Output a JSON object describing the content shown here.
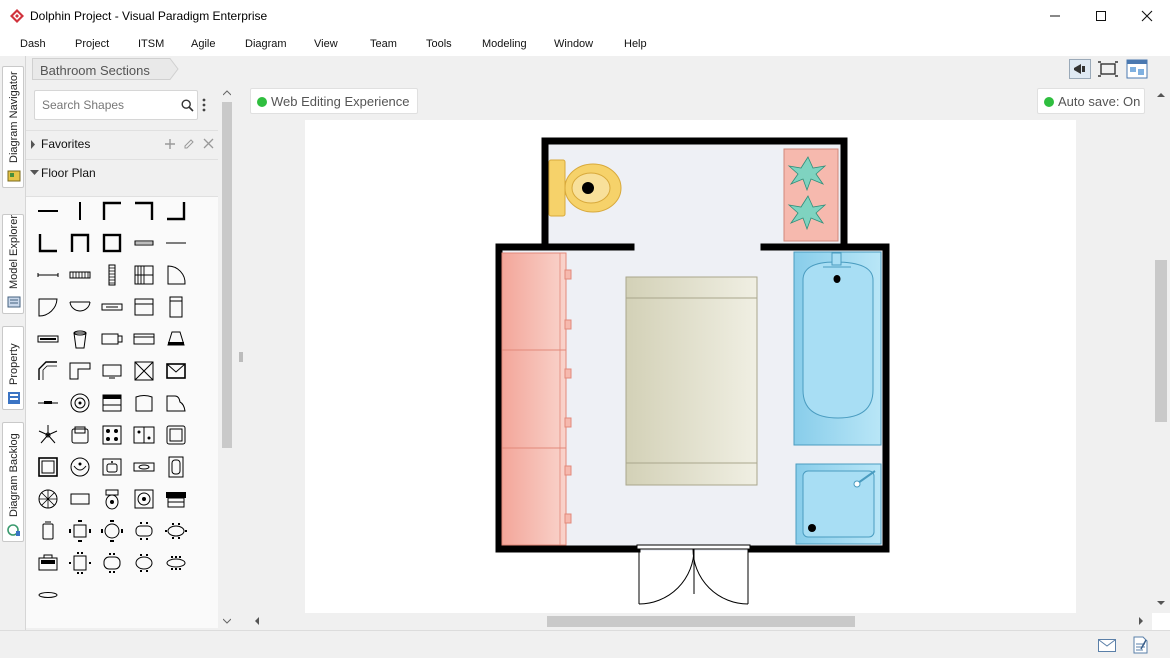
{
  "window": {
    "title": "Dolphin Project - Visual Paradigm Enterprise",
    "controls": [
      "minimize-icon",
      "maximize-icon",
      "close-icon"
    ]
  },
  "menu": [
    "Dash",
    "Project",
    "ITSM",
    "Agile",
    "Diagram",
    "View",
    "Team",
    "Tools",
    "Modeling",
    "Window",
    "Help"
  ],
  "side_tabs": [
    "Diagram Navigator",
    "Model Explorer",
    "Property",
    "Diagram Backlog"
  ],
  "breadcrumb": {
    "label": "Bathroom Sections"
  },
  "toolbar_icons": [
    "announcement-icon",
    "fit-diagram-icon",
    "diagram-overview-icon"
  ],
  "shape_panel": {
    "search_placeholder": "Search Shapes",
    "sections": [
      {
        "label": "Favorites",
        "expanded": false,
        "actions": [
          "add-icon",
          "edit-icon",
          "remove-icon"
        ]
      },
      {
        "label": "Floor Plan",
        "expanded": true
      }
    ],
    "shape_rows": 13
  },
  "canvas": {
    "editing_status": "Web Editing Experience",
    "autosave_status": "Auto save: On",
    "status_color": "#2fbe3f",
    "diagram": {
      "type": "bathroom-floor-plan",
      "fixtures": [
        "toilet",
        "planter",
        "cabinet",
        "bathroom-mat",
        "bathtub",
        "shower-tray",
        "double-door"
      ]
    }
  },
  "statusbar_icons": [
    "mail-icon",
    "document-icon"
  ],
  "colors": {
    "accent": "#2fbe3f",
    "wall": "#000000",
    "bathtub": "#9fd8f0",
    "cabinet": "#f6b9ae",
    "mat": "#d8d6c0",
    "floor": "#eef0f5"
  }
}
